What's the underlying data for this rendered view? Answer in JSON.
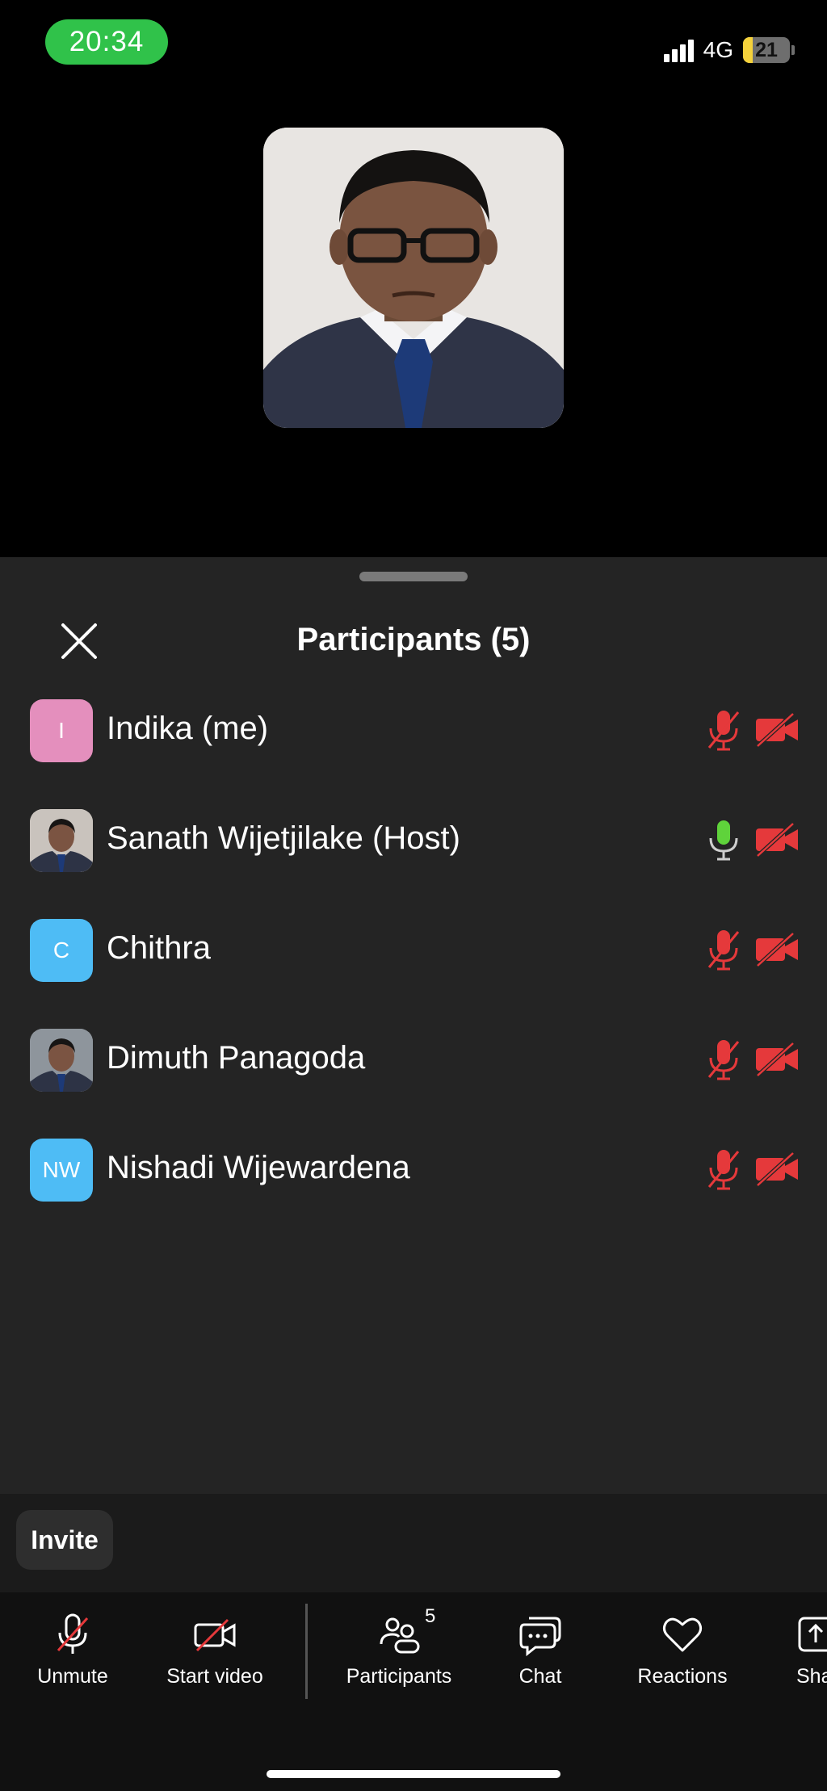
{
  "status_bar": {
    "time": "20:34",
    "network": "4G",
    "battery": "21",
    "battery_level_percent": 21
  },
  "video": {
    "speaker_photo": "participant-photo"
  },
  "sheet": {
    "title": "Participants (5)",
    "close_icon": "close-icon"
  },
  "participants": [
    {
      "name": "Indika (me)",
      "initials": "I",
      "avatar_color": "#e48fbd",
      "has_photo": false,
      "mic": "muted",
      "video": "off"
    },
    {
      "name": "Sanath Wijetjilake (Host)",
      "initials": "",
      "avatar_color": "#c9c3bd",
      "has_photo": true,
      "mic": "active",
      "video": "off"
    },
    {
      "name": "Chithra",
      "initials": "C",
      "avatar_color": "#4ebcf5",
      "has_photo": false,
      "mic": "muted",
      "video": "off"
    },
    {
      "name": "Dimuth Panagoda",
      "initials": "",
      "avatar_color": "#8e959c",
      "has_photo": true,
      "mic": "muted",
      "video": "off"
    },
    {
      "name": "Nishadi Wijewardena",
      "initials": "NW",
      "avatar_color": "#4ebcf5",
      "has_photo": false,
      "mic": "muted",
      "video": "off"
    }
  ],
  "invite": {
    "label": "Invite"
  },
  "toolbar": {
    "unmute": "Unmute",
    "start_video": "Start video",
    "participants": "Participants",
    "participants_count": "5",
    "chat": "Chat",
    "reactions": "Reactions",
    "share": "Sha"
  },
  "colors": {
    "muted_red": "#e5393b",
    "active_green": "#5fd33b",
    "sheet_bg": "#242424"
  }
}
